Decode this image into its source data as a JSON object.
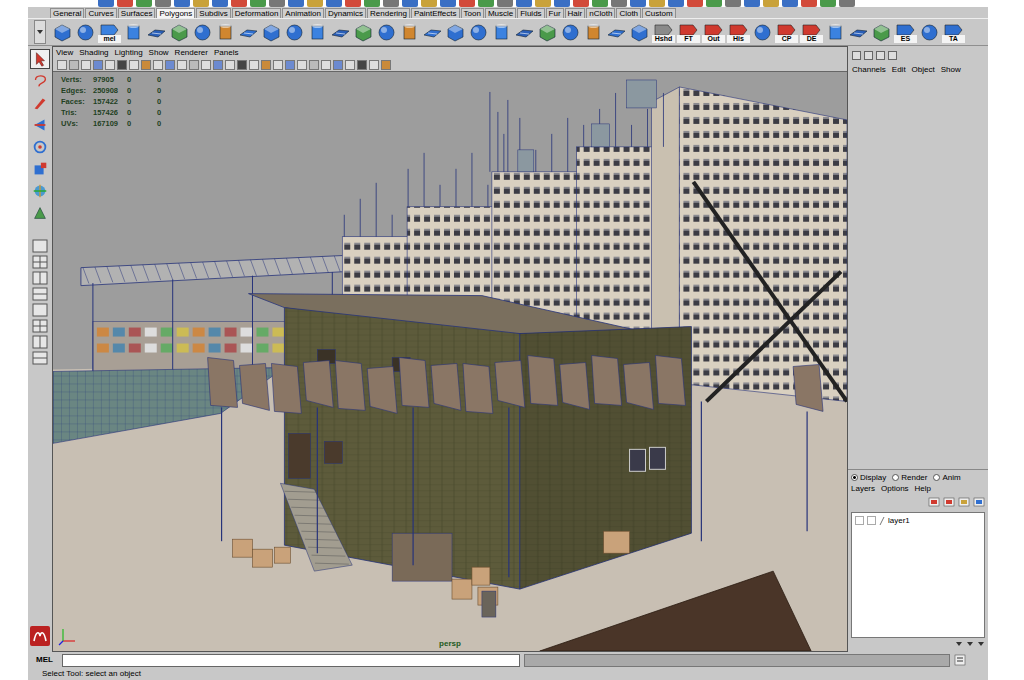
{
  "shelf_tabs": [
    {
      "label": "General",
      "selected": false
    },
    {
      "label": "Curves",
      "selected": false
    },
    {
      "label": "Surfaces",
      "selected": false
    },
    {
      "label": "Polygons",
      "selected": true
    },
    {
      "label": "Subdivs",
      "selected": false
    },
    {
      "label": "Deformation",
      "selected": false
    },
    {
      "label": "Animation",
      "selected": false
    },
    {
      "label": "Dynamics",
      "selected": false
    },
    {
      "label": "Rendering",
      "selected": false
    },
    {
      "label": "PaintEffects",
      "selected": false
    },
    {
      "label": "Toon",
      "selected": false
    },
    {
      "label": "Muscle",
      "selected": false
    },
    {
      "label": "Fluids",
      "selected": false
    },
    {
      "label": "Fur",
      "selected": false
    },
    {
      "label": "Hair",
      "selected": false
    },
    {
      "label": "nCloth",
      "selected": false
    },
    {
      "label": "Cloth",
      "selected": false
    },
    {
      "label": "Custom",
      "selected": false
    }
  ],
  "shelf": {
    "buttons": [
      {
        "label": "mel"
      },
      {
        "label": "Hshd"
      },
      {
        "label": "FT"
      },
      {
        "label": "Out"
      },
      {
        "label": "His"
      },
      {
        "label": "CP"
      },
      {
        "label": "DE"
      },
      {
        "label": "ES"
      },
      {
        "label": "TA"
      }
    ]
  },
  "tools": [
    {
      "selected": true
    },
    {
      "selected": false
    },
    {
      "selected": false
    },
    {
      "selected": false
    },
    {
      "selected": false
    },
    {
      "selected": false
    },
    {
      "selected": false
    },
    {
      "selected": false
    }
  ],
  "panel_menu": [
    "View",
    "Shading",
    "Lighting",
    "Show",
    "Renderer",
    "Panels"
  ],
  "hud": [
    {
      "label": "Verts:",
      "values": [
        "97905",
        "0",
        "0"
      ]
    },
    {
      "label": "Edges:",
      "values": [
        "250908",
        "0",
        "0"
      ]
    },
    {
      "label": "Faces:",
      "values": [
        "157422",
        "0",
        "0"
      ]
    },
    {
      "label": "Tris:",
      "values": [
        "157426",
        "0",
        "0"
      ]
    },
    {
      "label": "UVs:",
      "values": [
        "167109",
        "0",
        "0"
      ]
    }
  ],
  "camera": "persp",
  "channel_box": {
    "menu": [
      "Channels",
      "Edit",
      "Object",
      "Show"
    ]
  },
  "layer_editor": {
    "modes": [
      {
        "label": "Display",
        "selected": true
      },
      {
        "label": "Render",
        "selected": false
      },
      {
        "label": "Anim",
        "selected": false
      }
    ],
    "menu": [
      "Layers",
      "Options",
      "Help"
    ],
    "layers": [
      {
        "name": "layer1"
      }
    ]
  },
  "command_line": {
    "label": "MEL"
  },
  "help_line": "Select Tool: select an object"
}
